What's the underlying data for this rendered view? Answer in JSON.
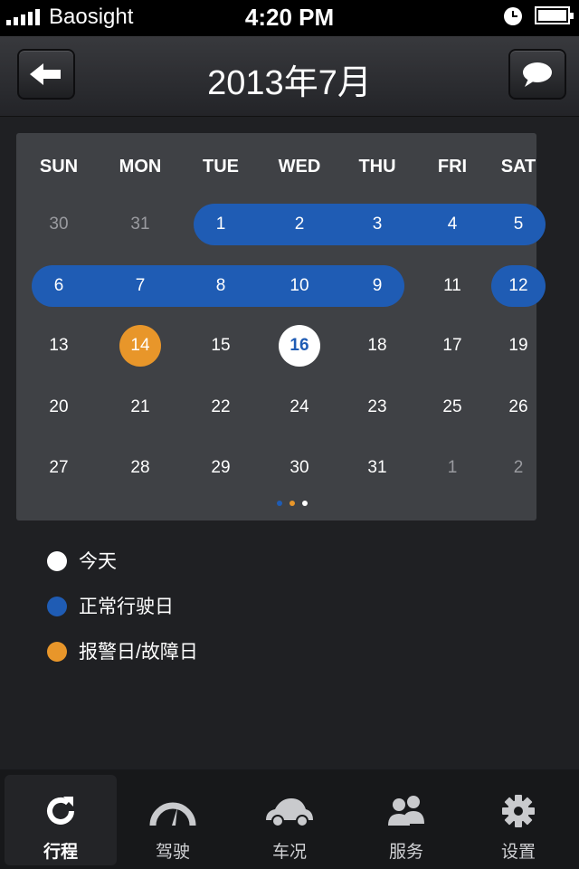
{
  "status_bar": {
    "carrier": "Baosight",
    "time": "4:20 PM"
  },
  "nav": {
    "title": "2013年7月",
    "back_icon": "arrow-left-icon",
    "message_icon": "speech-bubble-icon"
  },
  "calendar": {
    "weekdays": [
      "SUN",
      "MON",
      "TUE",
      "WED",
      "THU",
      "FRI",
      "SAT"
    ],
    "weeks": [
      [
        {
          "d": "30",
          "muted": true
        },
        {
          "d": "31",
          "muted": true
        },
        {
          "d": "1",
          "normal": true
        },
        {
          "d": "2",
          "normal": true
        },
        {
          "d": "3",
          "normal": true
        },
        {
          "d": "4",
          "normal": true
        },
        {
          "d": "5",
          "normal": true
        }
      ],
      [
        {
          "d": "6",
          "normal": true
        },
        {
          "d": "7",
          "normal": true
        },
        {
          "d": "8",
          "normal": true
        },
        {
          "d": "10",
          "normal": true
        },
        {
          "d": "9",
          "normal": true
        },
        {
          "d": "11"
        },
        {
          "d": "12",
          "normal": true
        }
      ],
      [
        {
          "d": "13"
        },
        {
          "d": "14",
          "alarm": true
        },
        {
          "d": "15"
        },
        {
          "d": "16",
          "today": true
        },
        {
          "d": "18"
        },
        {
          "d": "17"
        },
        {
          "d": "19"
        }
      ],
      [
        {
          "d": "20"
        },
        {
          "d": "21"
        },
        {
          "d": "22"
        },
        {
          "d": "24"
        },
        {
          "d": "23"
        },
        {
          "d": "25"
        },
        {
          "d": "26"
        }
      ],
      [
        {
          "d": "27"
        },
        {
          "d": "28"
        },
        {
          "d": "29"
        },
        {
          "d": "30"
        },
        {
          "d": "31"
        },
        {
          "d": "1",
          "muted": true
        },
        {
          "d": "2",
          "muted": true
        }
      ]
    ],
    "page_count": 3,
    "active_page": 3
  },
  "colors": {
    "normal": "#1f5cb4",
    "alarm": "#e8962a",
    "today": "#ffffff"
  },
  "legend": {
    "today": "今天",
    "normal": "正常行驶日",
    "alarm": "报警日/故障日"
  },
  "tabs": [
    {
      "label": "行程",
      "icon": "refresh-icon",
      "active": true
    },
    {
      "label": "驾驶",
      "icon": "speedometer-icon",
      "active": false
    },
    {
      "label": "车况",
      "icon": "car-icon",
      "active": false
    },
    {
      "label": "服务",
      "icon": "users-icon",
      "active": false
    },
    {
      "label": "设置",
      "icon": "gear-icon",
      "active": false
    }
  ]
}
